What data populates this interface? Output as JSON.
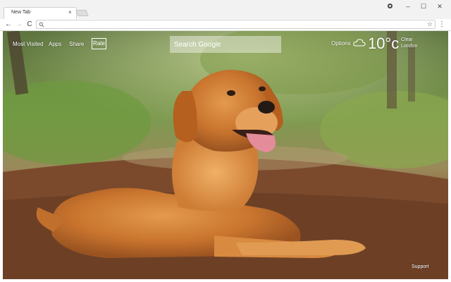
{
  "browser": {
    "tab_title": "New Tab",
    "tab_close": "×",
    "window_controls": {
      "minimize": "–",
      "maximize": "☐",
      "close": "✕"
    },
    "nav": {
      "back": "←",
      "forward": "→",
      "reload": "C"
    },
    "address_value": "",
    "bookmark_star": "☆",
    "menu": "⋮"
  },
  "newtab": {
    "links": {
      "most_visited": "Most Visited",
      "apps": "Apps",
      "share": "Share",
      "rate": "Rate"
    },
    "search": {
      "placeholder": "Search Google"
    },
    "options": "Options",
    "weather": {
      "temperature": "10°c",
      "condition": "Clear",
      "city": "London",
      "icon": "cloud-icon"
    },
    "support": "Support",
    "background": "golden retriever lying on a forest dirt path"
  },
  "colors": {
    "chrome_bg": "#f2f2f2",
    "toolbar_bg": "#ffffff",
    "overlay_text": "#ffffff"
  }
}
